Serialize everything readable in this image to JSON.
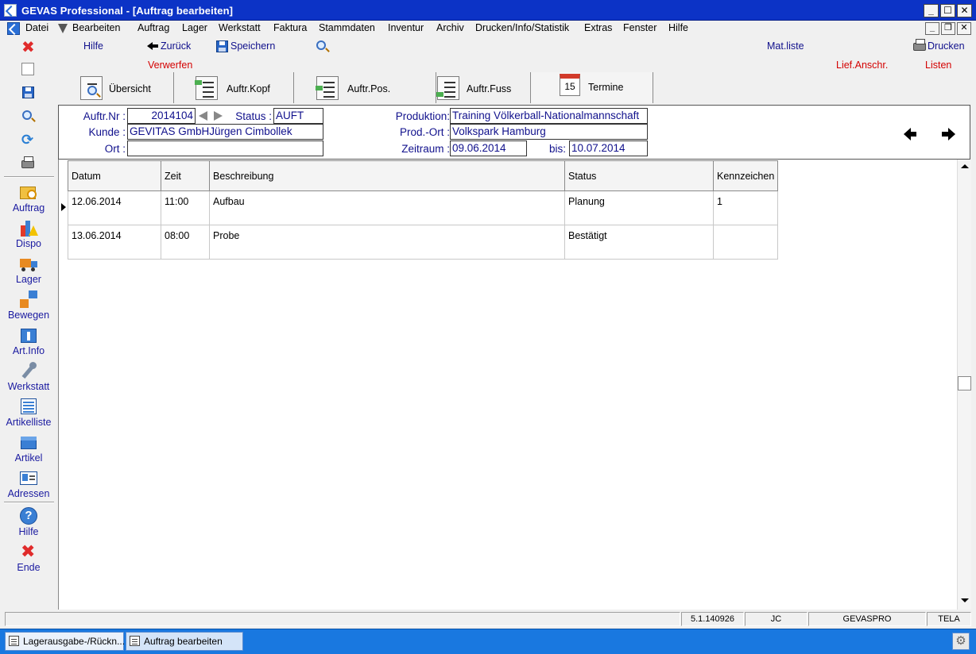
{
  "window": {
    "title": "GEVAS Professional - [Auftrag bearbeiten]",
    "btn_min": "_",
    "btn_max": "☐",
    "btn_close": "✕"
  },
  "menu": {
    "items": [
      "Datei",
      "Bearbeiten",
      "Auftrag",
      "Lager",
      "Werkstatt",
      "Faktura",
      "Stammdaten",
      "Inventur",
      "Archiv",
      "Drucken/Info/Statistik",
      "Extras",
      "Fenster",
      "Hilfe"
    ],
    "mdi_min": "_",
    "mdi_restore": "❐",
    "mdi_close": "✕"
  },
  "toolbar": {
    "hilfe": "Hilfe",
    "zurueck": "Zurück",
    "speichern": "Speichern",
    "verwerfen": "Verwerfen",
    "matliste": "Mat.liste",
    "drucken": "Drucken",
    "lief_anschr": "Lief.Anschr.",
    "listen": "Listen"
  },
  "sidebar": {
    "items": [
      "Auftrag",
      "Dispo",
      "Lager",
      "Bewegen",
      "Art.Info",
      "Werkstatt",
      "Artikelliste",
      "Artikel",
      "Adressen",
      "Hilfe",
      "Ende"
    ]
  },
  "tabs": [
    {
      "label": "Übersicht"
    },
    {
      "label": "Auftr.Kopf"
    },
    {
      "label": "Auftr.Pos."
    },
    {
      "label": "Auftr.Fuss"
    },
    {
      "label": "Termine",
      "icon_number": "15"
    }
  ],
  "header": {
    "auftr_nr_label": "Auftr.Nr :",
    "auftr_nr": "2014104",
    "status_label": "Status :",
    "status": "AUFT",
    "kunde_label": "Kunde :",
    "kunde": "GEVITAS GmbHJürgen Cimbollek",
    "ort_label": "Ort :",
    "ort": "",
    "produktion_label": "Produktion:",
    "produktion": "Training Völkerball-Nationalmannschaft",
    "prod_ort_label": "Prod.-Ort :",
    "prod_ort": "Volkspark Hamburg",
    "zeitraum_label": "Zeitraum :",
    "zeitraum_von": "09.06.2014",
    "bis_label": "bis:",
    "zeitraum_bis": "10.07.2014"
  },
  "grid": {
    "columns": [
      "Datum",
      "Zeit",
      "Beschreibung",
      "Status",
      "Kennzeichen"
    ],
    "rows": [
      [
        "12.06.2014",
        "11:00",
        "Aufbau",
        "Planung",
        "1"
      ],
      [
        "13.06.2014",
        "08:00",
        "Probe",
        "Bestätigt",
        ""
      ]
    ]
  },
  "statusbar": {
    "version": "5.1.140926",
    "user": "JC",
    "database": "GEVASPRO",
    "terminal": "TELA"
  },
  "taskbar": {
    "tasks": [
      "Lagerausgabe-/Rückn...",
      "Auftrag bearbeiten"
    ]
  },
  "colors": {
    "titlebar": "#0c33c6",
    "taskbar": "#1978e0",
    "link_blue": "#10108c",
    "link_red": "#d40000"
  }
}
